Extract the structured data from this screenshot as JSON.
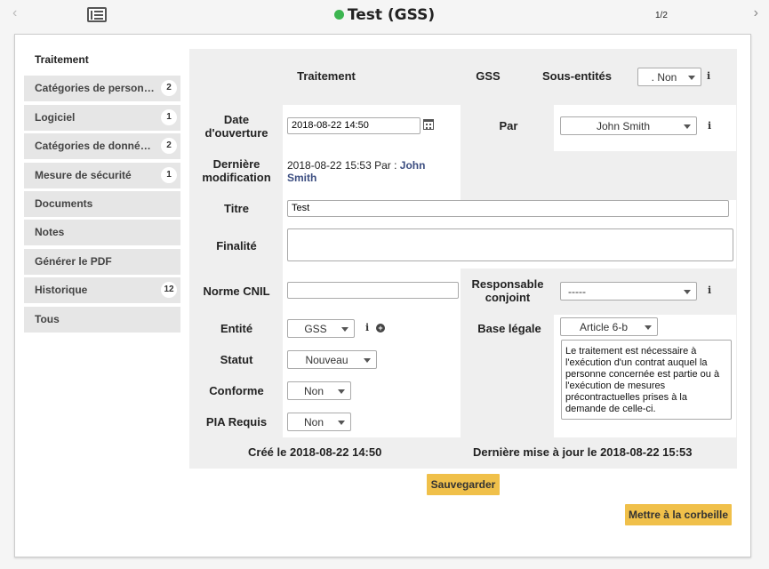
{
  "header": {
    "title": "Test (GSS)",
    "status_color": "#3cb550",
    "pager": "1/2",
    "prev_icon": "‹",
    "next_icon": "›"
  },
  "sidebar": {
    "items": [
      {
        "label": "Traitement",
        "badge": ""
      },
      {
        "label": "Catégories de person…",
        "badge": "2"
      },
      {
        "label": "Logiciel",
        "badge": "1"
      },
      {
        "label": "Catégories de donné…",
        "badge": "2"
      },
      {
        "label": "Mesure de sécurité",
        "badge": "1"
      },
      {
        "label": "Documents",
        "badge": ""
      },
      {
        "label": "Notes",
        "badge": ""
      },
      {
        "label": "Générer le PDF",
        "badge": ""
      },
      {
        "label": "Historique",
        "badge": "12"
      },
      {
        "label": "Tous",
        "badge": ""
      }
    ]
  },
  "form": {
    "header_traitement": "Traitement",
    "header_gss": "GSS",
    "sous_entites_label": "Sous-entités",
    "sous_entites_value": ". Non",
    "date_ouverture_label": "Date d'ouverture",
    "date_ouverture_value": "2018-08-22 14:50",
    "par_label": "Par",
    "par_value": "John Smith",
    "derniere_modif_label": "Dernière modification",
    "derniere_modif_text": "2018-08-22 15:53 Par : ",
    "derniere_modif_user": "John Smith",
    "titre_label": "Titre",
    "titre_value": "Test",
    "finalite_label": "Finalité",
    "finalite_value": "",
    "norme_cnil_label": "Norme CNIL",
    "norme_cnil_value": "",
    "responsable_label": "Responsable conjoint",
    "responsable_value": "-----",
    "entite_label": "Entité",
    "entite_value": "GSS",
    "base_legale_label": "Base légale",
    "base_legale_value": "Article 6-b",
    "base_legale_desc": "Le traitement est nécessaire à l'exécution d'un contrat auquel la personne concernée est partie ou à l'exécution de mesures précontractuelles prises à la demande de celle-ci.",
    "statut_label": "Statut",
    "statut_value": "Nouveau",
    "conforme_label": "Conforme",
    "conforme_value": "Non",
    "pia_label": "PIA Requis",
    "pia_value": "Non",
    "cree_le": "Créé le 2018-08-22 14:50",
    "maj_le": "Dernière mise à jour le 2018-08-22 15:53",
    "info_icon": "i",
    "plus_icon": "+"
  },
  "actions": {
    "save_label": "Sauvegarder",
    "trash_label": "Mettre à la corbeille"
  },
  "colors": {
    "button": "#f0c04a",
    "user_link": "#3b4d80"
  }
}
